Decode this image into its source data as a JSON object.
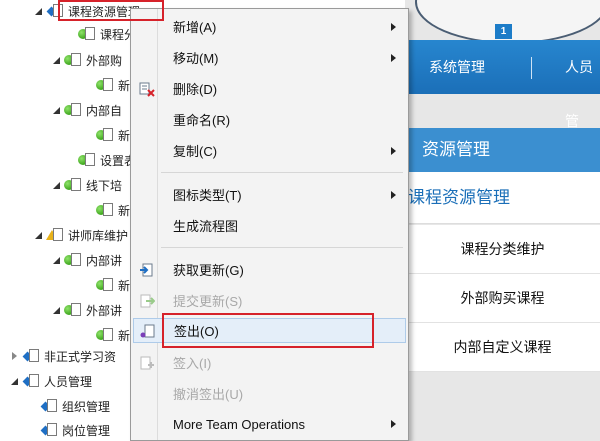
{
  "tree": {
    "items": [
      {
        "label": "课程资源管理"
      },
      {
        "label": "课程分"
      },
      {
        "label": "外部购"
      },
      {
        "label": "新"
      },
      {
        "label": "内部自"
      },
      {
        "label": "新"
      },
      {
        "label": "设置表"
      },
      {
        "label": "线下培"
      },
      {
        "label": "新"
      },
      {
        "label": "讲师库维护"
      },
      {
        "label": "内部讲"
      },
      {
        "label": "新"
      },
      {
        "label": "外部讲"
      },
      {
        "label": "新"
      },
      {
        "label": "非正式学习资"
      },
      {
        "label": "人员管理"
      },
      {
        "label": "组织管理"
      },
      {
        "label": "岗位管理"
      }
    ]
  },
  "context_menu": {
    "items": [
      {
        "label": "新增(A)"
      },
      {
        "label": "移动(M)"
      },
      {
        "label": "删除(D)"
      },
      {
        "label": "重命名(R)"
      },
      {
        "label": "复制(C)"
      },
      {
        "label": "图标类型(T)"
      },
      {
        "label": "生成流程图"
      },
      {
        "label": "获取更新(G)"
      },
      {
        "label": "提交更新(S)"
      },
      {
        "label": "签出(O)"
      },
      {
        "label": "签入(I)"
      },
      {
        "label": "撤消签出(U)"
      },
      {
        "label": "More Team Operations"
      }
    ]
  },
  "app": {
    "badge": "1",
    "nav": {
      "system": "系统管理",
      "people": "人员管"
    },
    "panel": {
      "header": "资源管理",
      "subheader": "课程资源管理",
      "links": [
        "课程分类维护",
        "外部购买课程",
        "内部自定义课程"
      ]
    }
  },
  "colors": {
    "nav_blue": "#1b6fb8",
    "panel_blue": "#3b8fd0",
    "highlight_red": "#d6222a",
    "menu_bg": "#f3f3f3"
  }
}
